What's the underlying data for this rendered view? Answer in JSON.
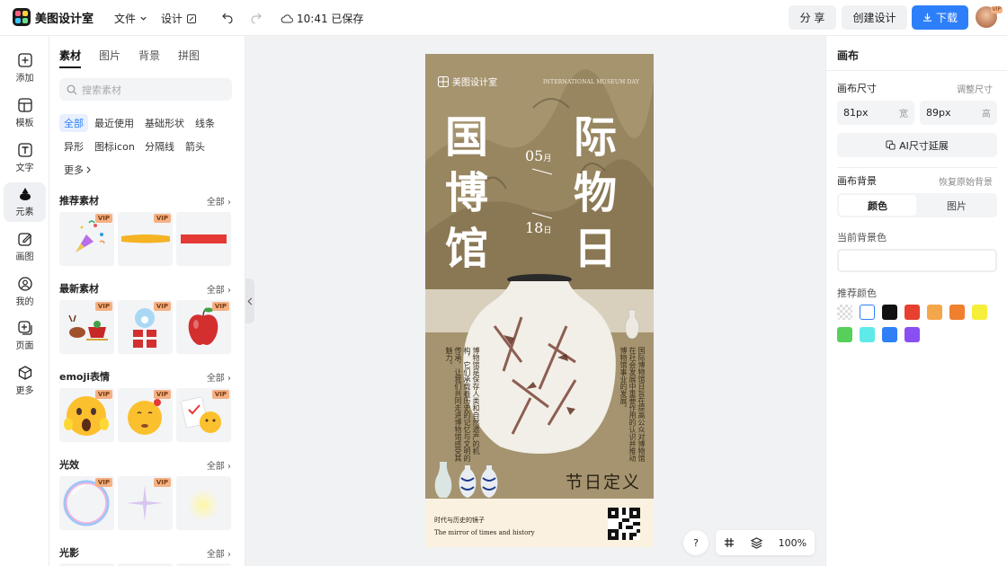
{
  "app": {
    "name": "美图设计室"
  },
  "topbar": {
    "file_menu": "文件",
    "design_menu": "设计",
    "save_status": "10:41 已保存",
    "share_label": "分 享",
    "create_label": "创建设计",
    "download_label": "下载",
    "vip_badge": "VIP"
  },
  "rail": {
    "items": [
      {
        "label": "添加",
        "icon": "plus-square-icon"
      },
      {
        "label": "模板",
        "icon": "template-icon"
      },
      {
        "label": "文字",
        "icon": "text-icon"
      },
      {
        "label": "元素",
        "icon": "shapes-icon"
      },
      {
        "label": "画图",
        "icon": "pencil-icon"
      },
      {
        "label": "我的",
        "icon": "user-icon"
      },
      {
        "label": "页面",
        "icon": "add-page-icon"
      },
      {
        "label": "更多",
        "icon": "cube-icon"
      }
    ],
    "active_index": 3
  },
  "panel": {
    "tabs": [
      "素材",
      "图片",
      "背景",
      "拼图"
    ],
    "search_placeholder": "搜索素材",
    "chips": [
      "全部",
      "最近使用",
      "基础形状",
      "线条",
      "异形",
      "图标icon",
      "分隔线",
      "箭头",
      "更多"
    ],
    "all_label": "全部",
    "sections": [
      {
        "title": "推荐素材"
      },
      {
        "title": "最新素材"
      },
      {
        "title": "emoji表情"
      },
      {
        "title": "光效"
      },
      {
        "title": "光影"
      }
    ],
    "vip_label": "VIP"
  },
  "poster": {
    "brand": "美图设计室",
    "banner_en": "INTERNATIONAL MUSEUM DAY",
    "title_left": [
      "国",
      "博",
      "馆"
    ],
    "title_right": [
      "际",
      "物",
      "日"
    ],
    "month": "05",
    "month_unit": "月",
    "day": "18",
    "day_unit": "日",
    "left_paragraph": "博物馆是保存人类和自然遗产的机构，它们承载着历史的记忆与文明的传承，让我们共同走进博物馆感受其魅力。",
    "right_paragraph": "国际博物馆日旨在提高公众对博物馆在社会发展中重要作用的认识并推动博物馆事业的发展。",
    "festival_title": "节日定义",
    "footer_cn": "时代与历史的镜子",
    "footer_en": "The mirror of times and history"
  },
  "bottom": {
    "help": "?",
    "zoom": "100%"
  },
  "right": {
    "heading": "画布",
    "size_label": "画布尺寸",
    "resize_link": "调整尺寸",
    "width_value": "81px",
    "width_unit": "宽",
    "height_value": "89px",
    "height_unit": "高",
    "ai_extend": "AI尺寸延展",
    "bg_label": "画布背景",
    "restore_link": "恢复原始背景",
    "bg_tabs": [
      "颜色",
      "图片"
    ],
    "current_bg": "当前背景色",
    "recommend": "推荐颜色",
    "swatches": [
      "transparent",
      "#ffffff",
      "#111111",
      "#e8402f",
      "#f4a64a",
      "#f07f2e",
      "#f6ef3a",
      "#56d05a",
      "#5fe9e9",
      "#2f7ff6",
      "#8a4ff2"
    ]
  },
  "colors": {
    "accent": "#2d7ff9"
  }
}
